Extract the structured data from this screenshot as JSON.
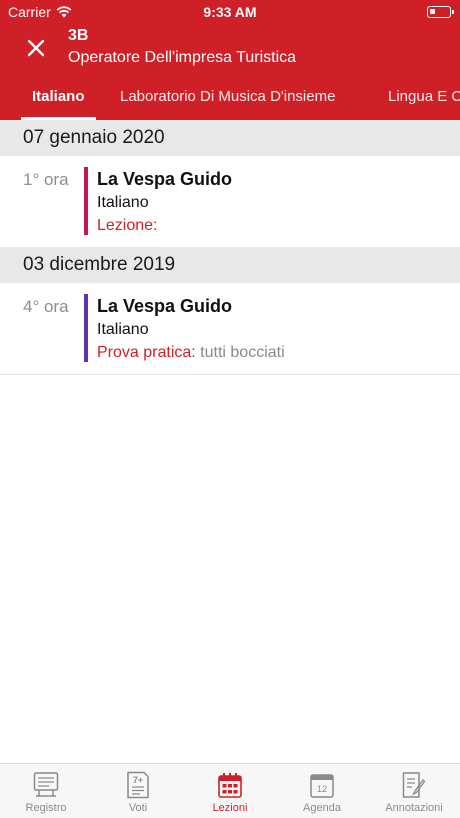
{
  "status_bar": {
    "carrier": "Carrier",
    "time": "9:33 AM"
  },
  "header": {
    "class_code": "3B",
    "class_name": "Operatore Dell'impresa Turistica"
  },
  "tabs": [
    {
      "label": "Italiano",
      "active": true
    },
    {
      "label": "Laboratorio Di Musica D'insieme",
      "active": false
    },
    {
      "label": "Lingua E C",
      "active": false
    }
  ],
  "sections": [
    {
      "date": "07 gennaio 2020",
      "lessons": [
        {
          "hour": "1° ora",
          "teacher": "La Vespa Guido",
          "subject": "Italiano",
          "note_kind": "Lezione:",
          "note_text": "",
          "color": "#c2185b"
        }
      ]
    },
    {
      "date": "03 dicembre 2019",
      "lessons": [
        {
          "hour": "4° ora",
          "teacher": "La Vespa Guido",
          "subject": "Italiano",
          "note_kind": "Prova pratica:",
          "note_text": "tutti bocciati",
          "color": "#5e35b1"
        }
      ]
    }
  ],
  "tabbar": [
    {
      "label": "Registro",
      "icon": "register-icon",
      "active": false
    },
    {
      "label": "Voti",
      "icon": "grades-icon",
      "active": false
    },
    {
      "label": "Lezioni",
      "icon": "calendar-grid-icon",
      "active": true
    },
    {
      "label": "Agenda",
      "icon": "calendar-day-icon",
      "day": "12",
      "active": false
    },
    {
      "label": "Annotazioni",
      "icon": "notes-icon",
      "active": false
    }
  ],
  "grade_icon_text": "7+",
  "colors": {
    "brand": "#cf2027",
    "header_bg": "#cf2027",
    "inactive_tab": "#8a8a8a"
  }
}
